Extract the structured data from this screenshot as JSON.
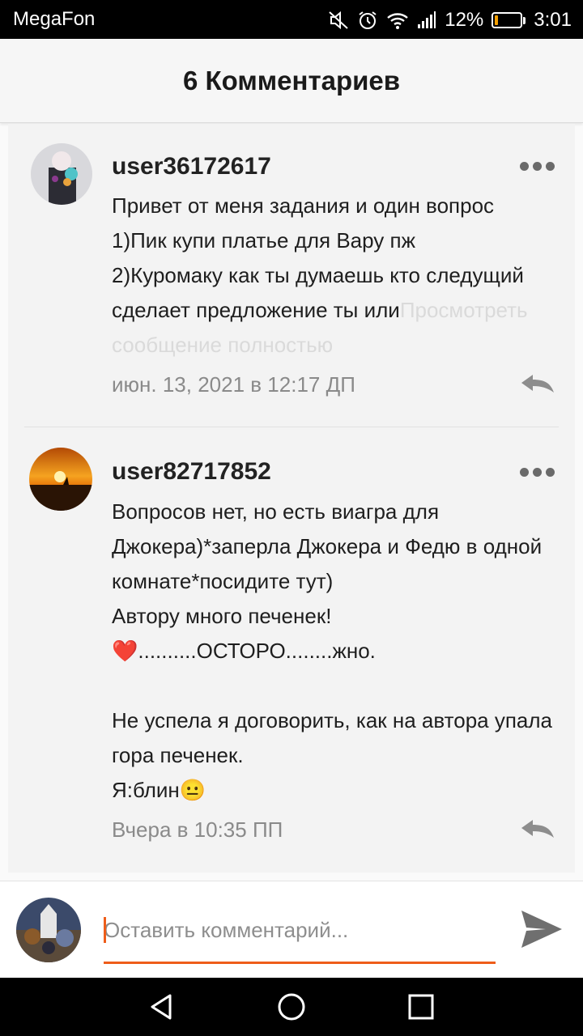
{
  "status_bar": {
    "carrier": "MegaFon",
    "battery_percent": "12%",
    "battery_level": 0.12,
    "time": "3:01",
    "icons": [
      "mute-icon",
      "alarm-icon",
      "wifi-icon",
      "signal-icon",
      "battery-icon"
    ]
  },
  "header": {
    "title": "6 Комментариев"
  },
  "comments": [
    {
      "username": "user36172617",
      "text": "Привет от меня задания и один вопрос\n1)Пик купи платье для Вару пж\n2)Куромаку как ты думаешь кто следущий сделает предложение ты или",
      "see_more": "Просмотреть сообщение полностью",
      "time": "июн. 13, 2021 в 12:17 ДП"
    },
    {
      "username": "user82717852",
      "text": "Вопросов нет, но есть виагра для Джокера)*заперла Джокера и Федю в одной комнате*посидите тут)\nАвтору много печенек!\n❤️..........ОСТОРО........жно.\n\nНе успела я договорить, как на автора упала гора печенек.\nЯ:блин😐",
      "time": "Вчера в 10:35 ПП"
    }
  ],
  "footer": {
    "input_placeholder": "Оставить комментарий...",
    "accent_color": "#ee5d1a"
  },
  "nav_bar": {
    "icons": [
      "back-icon",
      "home-icon",
      "recents-icon"
    ]
  }
}
